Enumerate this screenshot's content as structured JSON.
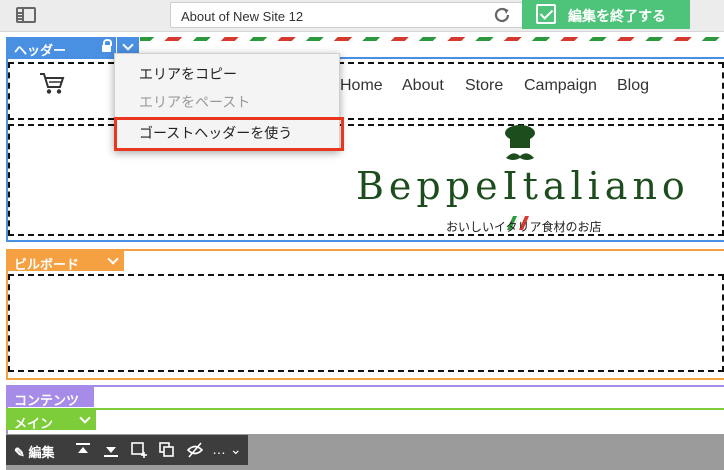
{
  "topbar": {
    "url": "About of New Site 12",
    "done_label": "編集を終了する"
  },
  "header_section": {
    "tag_label": "ヘッダー",
    "nav": [
      "Home",
      "About",
      "Store",
      "Campaign",
      "Blog"
    ],
    "logo_text": "BeppeItaliano",
    "logo_sub": "おいしいイタリア食材のお店"
  },
  "context_menu": {
    "items": [
      {
        "label": "エリアをコピー",
        "disabled": false
      },
      {
        "label": "エリアをペースト",
        "disabled": true
      },
      {
        "label": "ゴーストヘッダーを使う",
        "disabled": false,
        "highlighted": true
      }
    ]
  },
  "billboard": {
    "tag_label": "ビルボード"
  },
  "contents": {
    "tag_label": "コンテンツ"
  },
  "main": {
    "tag_label": "メイン"
  },
  "toolbar": {
    "edit_label": "編集",
    "more_label": "…"
  },
  "colors": {
    "header_accent": "#4a90e2",
    "billboard_accent": "#f5a142",
    "contents_accent": "#a78be8",
    "main_accent": "#7dcc3a",
    "done_button": "#4ec37a",
    "highlight_border": "#e8361f",
    "logo_green": "#1d4d1d"
  }
}
